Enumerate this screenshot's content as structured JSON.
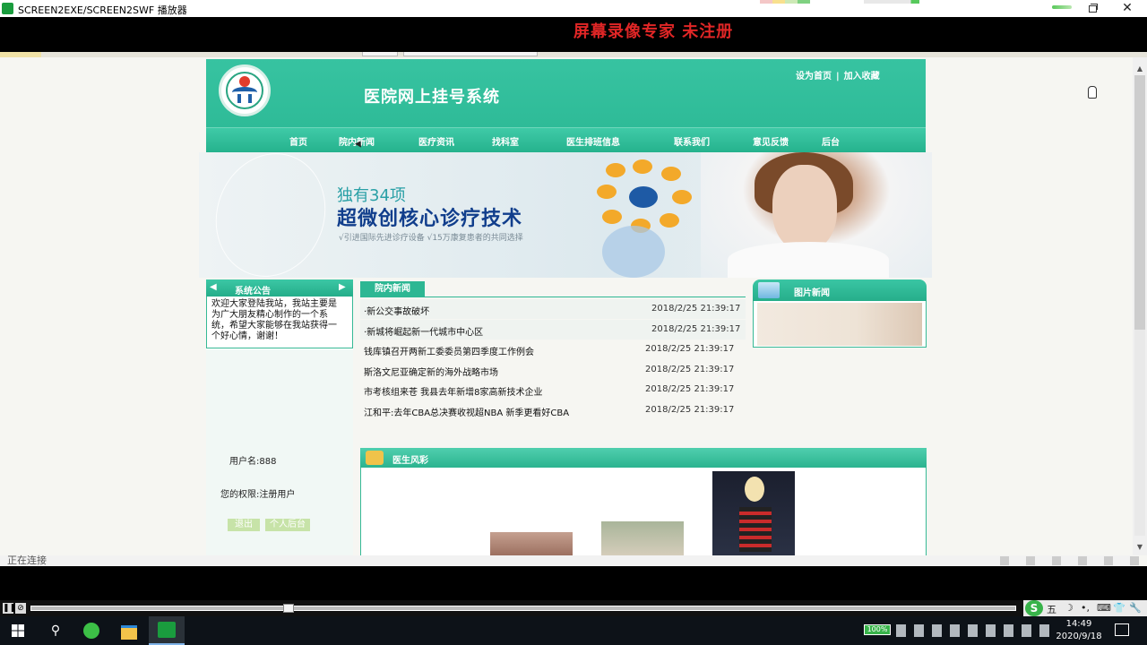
{
  "window": {
    "title": "SCREEN2EXE/SCREEN2SWF 播放器",
    "close_glyph": "✕",
    "watermark": "屏幕录像专家  未注册"
  },
  "site": {
    "title": "医院网上挂号系统",
    "top_links": [
      "设为首页",
      "加入收藏"
    ],
    "top_sep": "|",
    "nav": [
      "首页",
      "院内新闻",
      "医疗资讯",
      "找科室",
      "医生排班信息",
      "联系我们",
      "意见反馈",
      "后台"
    ],
    "banner": {
      "line1": "独有34项",
      "line2": "超微创核心诊疗技术",
      "line3": "√引进国际先进诊疗设备    √15万康复患者的共同选择",
      "core_label": "核心"
    },
    "notice": {
      "title": "系统公告",
      "text": "欢迎大家登陆我站，我站主要是为广大朋友精心制作的一个系统，希望大家能够在我站获得一个好心情，谢谢！"
    },
    "user": {
      "username_line": "用户名:888",
      "role_line": "您的权限:注册用户",
      "logout": "退出",
      "user_panel": "个人后台"
    },
    "news": {
      "tab": "院内新闻",
      "items": [
        {
          "title": "·新公交事故破坏",
          "date": "2018/2/25 21:39:17"
        },
        {
          "title": "·新城将崛起新一代城市中心区",
          "date": "2018/2/25 21:39:17"
        },
        {
          "title": "钱库镇召开两新工委委员第四季度工作例会",
          "date": "2018/2/25 21:39:17"
        },
        {
          "title": "斯洛文尼亚确定新的海外战略市场",
          "date": "2018/2/25 21:39:17"
        },
        {
          "title": "市考核组来苍 我县去年新增8家高新技术企业",
          "date": "2018/2/25 21:39:17"
        },
        {
          "title": "江和平:去年CBA总决赛收视超NBA 新季更看好CBA",
          "date": "2018/2/25 21:39:17"
        }
      ]
    },
    "picture_news": {
      "title": "图片新闻"
    },
    "gallery": {
      "title": "医生风彩"
    }
  },
  "browser": {
    "status": "正在连接"
  },
  "player": {
    "pause_glyph": "❚❚",
    "stop_glyph": "⊘",
    "ime": [
      "五",
      "☽",
      "•,",
      "⌨",
      "👕",
      "🔧"
    ]
  },
  "taskbar": {
    "battery": "100%",
    "time": "14:49",
    "date": "2020/9/18",
    "search_glyph": "⚲"
  },
  "icons": [
    "app-icon",
    "restore-icon",
    "close-icon",
    "hospital-logo-icon",
    "arrow-left-icon",
    "arrow-right-icon",
    "picture-news-icon",
    "gallery-icon",
    "windows-start-icon",
    "search-icon",
    "browser-icon",
    "folder-icon",
    "player-icon",
    "battery-icon",
    "notification-icon",
    "mouse-cursor-icon"
  ],
  "colors": {
    "site_green": "#2bb894",
    "watermark_red": "#e02626",
    "banner_blue": "#113e8c"
  }
}
